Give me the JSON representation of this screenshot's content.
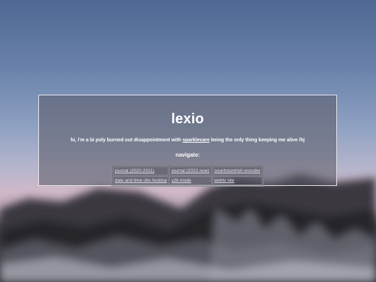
{
  "site": {
    "title": "lexio",
    "tagline_before": "hi, i'm a bi poly burned out disappointment with ",
    "tagline_link": "sparklecare",
    "tagline_after": " being the only thing keeping me alive /hj",
    "nav_heading": "navigate:"
  },
  "nav": {
    "rows": [
      [
        "journal (2020-2021)",
        "journal (2022-now)",
        "countrountrish encoder"
      ],
      [
        "date and time obs hosting",
        "y2k mode",
        "webtv site"
      ]
    ]
  },
  "colors": {
    "sky_top": "#4d6893",
    "sky_bottom": "#d0b8c8",
    "panel_border": "#e8e8ee"
  }
}
